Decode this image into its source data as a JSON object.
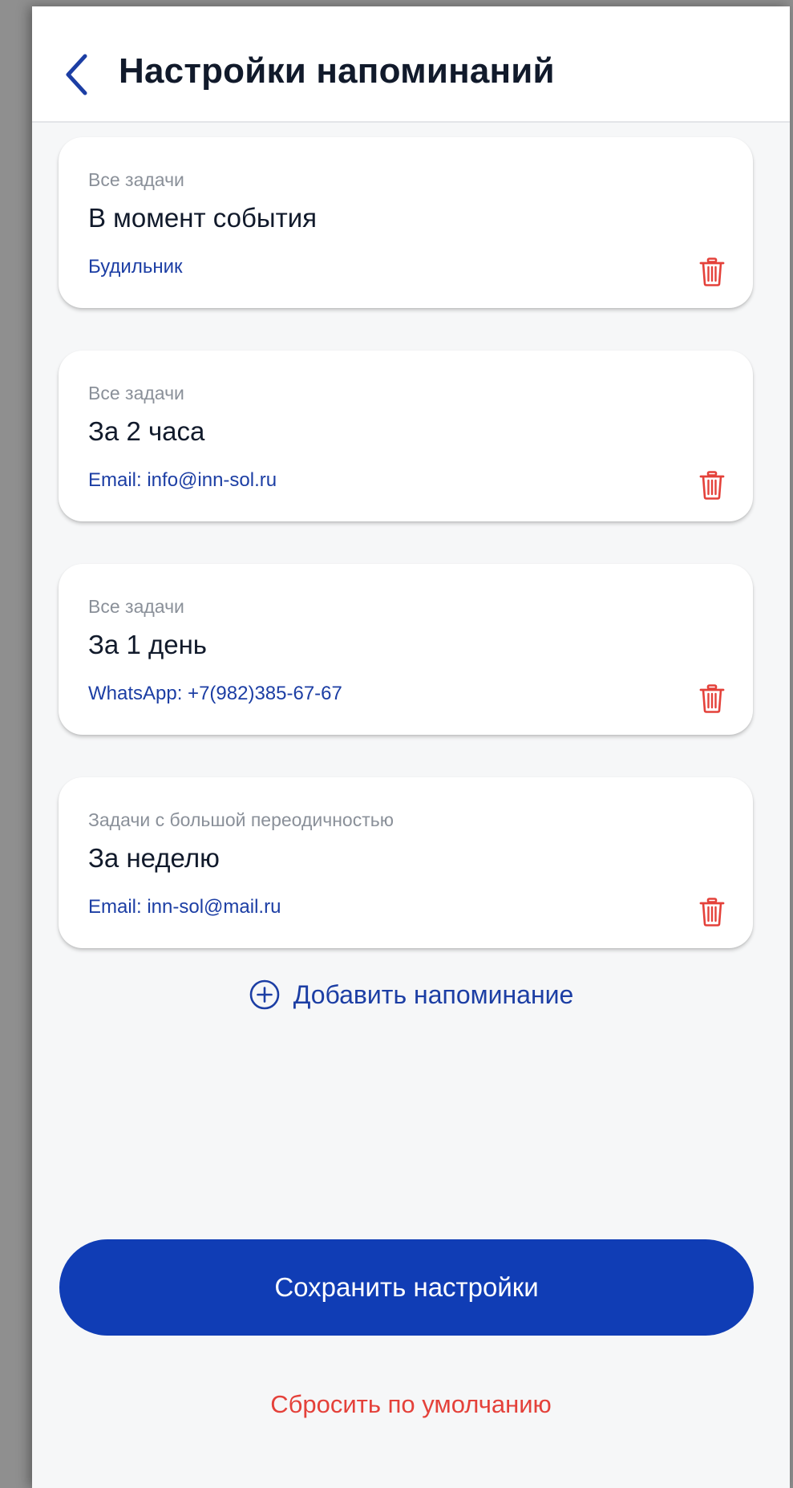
{
  "header": {
    "title": "Настройки напоминаний",
    "back_icon": "chevron-left-icon"
  },
  "colors": {
    "accent": "#103db5",
    "link": "#1c3ea4",
    "danger": "#e4413a",
    "background": "#f6f7f8"
  },
  "reminders": [
    {
      "category": "Все задачи",
      "title": "В момент события",
      "channel": "Будильник",
      "delete_icon": "trash-icon"
    },
    {
      "category": "Все задачи",
      "title": "За 2 часа",
      "channel": "Email: info@inn-sol.ru",
      "delete_icon": "trash-icon"
    },
    {
      "category": "Все задачи",
      "title": "За 1 день",
      "channel": "WhatsApp: +7(982)385-67-67",
      "delete_icon": "trash-icon"
    },
    {
      "category": "Задачи с большой переодичностью",
      "title": "За неделю",
      "channel": "Email: inn-sol@mail.ru",
      "delete_icon": "trash-icon"
    }
  ],
  "add_reminder": {
    "label": "Добавить напоминание",
    "icon": "plus-circle-icon"
  },
  "actions": {
    "save_label": "Сохранить настройки",
    "reset_label": "Сбросить по умолчанию"
  }
}
